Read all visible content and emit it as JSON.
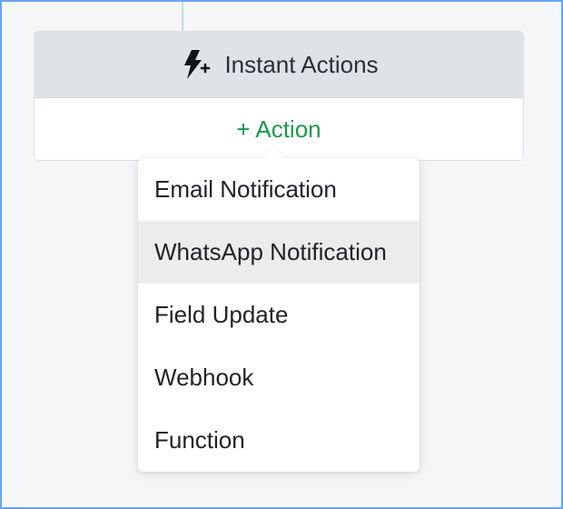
{
  "card": {
    "title": "Instant Actions",
    "icon": "lightning-plus-icon",
    "add_action_label": "+ Action"
  },
  "menu": {
    "items": [
      {
        "label": "Email Notification",
        "hovered": false
      },
      {
        "label": "WhatsApp Notification",
        "hovered": true
      },
      {
        "label": "Field Update",
        "hovered": false
      },
      {
        "label": "Webhook",
        "hovered": false
      },
      {
        "label": "Function",
        "hovered": false
      }
    ]
  },
  "colors": {
    "accent_green": "#1a9a4b",
    "header_bg": "#dee3e8",
    "hover_bg": "#ececec",
    "frame_border": "#6aa5f0"
  }
}
